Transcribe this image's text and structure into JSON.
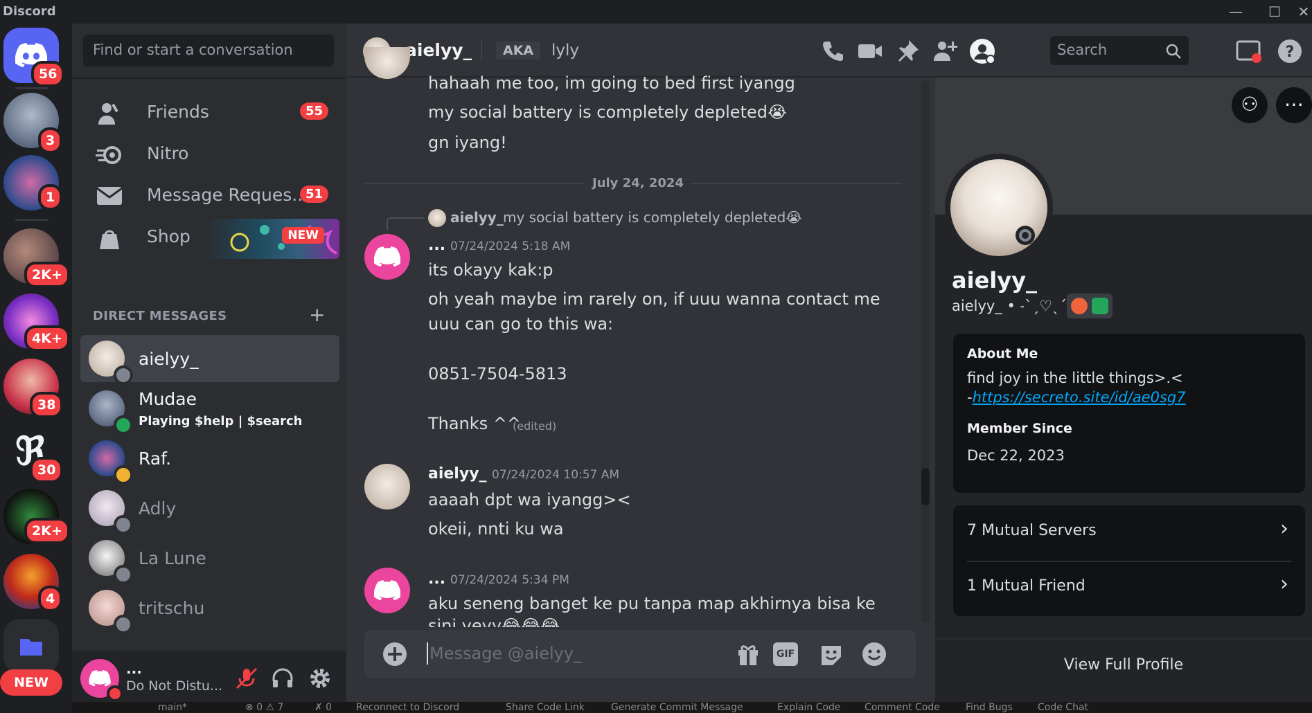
{
  "window": {
    "title": "Discord"
  },
  "rail": {
    "badges": [
      "56",
      "3",
      "1",
      "2K+",
      "4K+",
      "38",
      "30",
      "2K+",
      "4"
    ],
    "new_label": "NEW"
  },
  "dm_sidebar": {
    "search_placeholder": "Find or start a conversation",
    "nav": [
      {
        "label": "Friends",
        "badge": "55"
      },
      {
        "label": "Nitro",
        "badge": ""
      },
      {
        "label": "Message Reques...",
        "badge": "51"
      },
      {
        "label": "Shop",
        "badge": "NEW"
      }
    ],
    "direct_messages_header": "DIRECT MESSAGES",
    "add_dm": "+",
    "dms": [
      {
        "name": "aielyy_",
        "sub": ""
      },
      {
        "name": "Mudae",
        "sub": "Playing $help | $search"
      },
      {
        "name": "Raf.",
        "sub": ""
      },
      {
        "name": "Adly",
        "sub": ""
      },
      {
        "name": "La Lune",
        "sub": ""
      },
      {
        "name": "tritschu",
        "sub": ""
      }
    ]
  },
  "user_panel": {
    "name": "...",
    "status": "Do Not Distu..."
  },
  "chat_header": {
    "name": "aielyy_",
    "aka_label": "AKA",
    "aka_name": "lyly",
    "search_placeholder": "Search"
  },
  "messages": {
    "m1_line1": "hahaah me too, im going to bed first iyangg",
    "m1_line2": "my social battery is completely depleted😭",
    "m1_line3": "gn iyang!",
    "date_divider": "July 24, 2024",
    "reply_name": "aielyy_",
    "reply_text": "my social battery is completely depleted😭",
    "m2_author": "...",
    "m2_time": "07/24/2024 5:18 AM",
    "m2_line1": "its okayy kak:p",
    "m2_line2": "oh yeah maybe im rarely on, if uuu wanna contact me",
    "m2_line3": "uuu can go to this wa:",
    "m2_line4": "0851-7504-5813",
    "m2_line5": "Thanks ^^",
    "m2_edited": "(edited)",
    "m3_author": "aielyy_",
    "m3_time": "07/24/2024 10:57 AM",
    "m3_line1": "aaaah dpt wa iyangg><",
    "m3_line2": "okeii, nnti ku wa",
    "m4_author": "...",
    "m4_time": "07/24/2024 5:34 PM",
    "m4_line1": "aku seneng banget ke pu tanpa map akhirnya bisa ke",
    "m4_line2": "sini yeyy😂😂😂"
  },
  "composer": {
    "placeholder": "Message @aielyy_",
    "gif_label": "GIF"
  },
  "profile": {
    "display_name": "aielyy_",
    "username_line": "aielyy_ • ˗ˋˏ♡ˎˊ˗",
    "about_header": "About Me",
    "about_text": "find joy in the little things>.<",
    "about_link_prefix": "-",
    "about_link": "https://secreto.site/id/ae0sg7",
    "member_since_header": "Member Since",
    "member_since": "Dec 22, 2023",
    "mutual_servers": "7 Mutual Servers",
    "mutual_friends": "1 Mutual Friend",
    "view_full": "View Full Profile"
  },
  "statusbar": {
    "items": [
      "main*",
      "⊗ 0 ⚠ 7",
      "✗ 0",
      "Reconnect to Discord",
      "Share Code Link",
      "Generate Commit Message",
      "Explain Code",
      "Comment Code",
      "Find Bugs",
      "Code Chat"
    ]
  },
  "colors": {
    "brand": "#5865f2",
    "badge": "#f23f43",
    "pink": "#eb459e",
    "online": "#23a55a",
    "link": "#00a8fc"
  }
}
